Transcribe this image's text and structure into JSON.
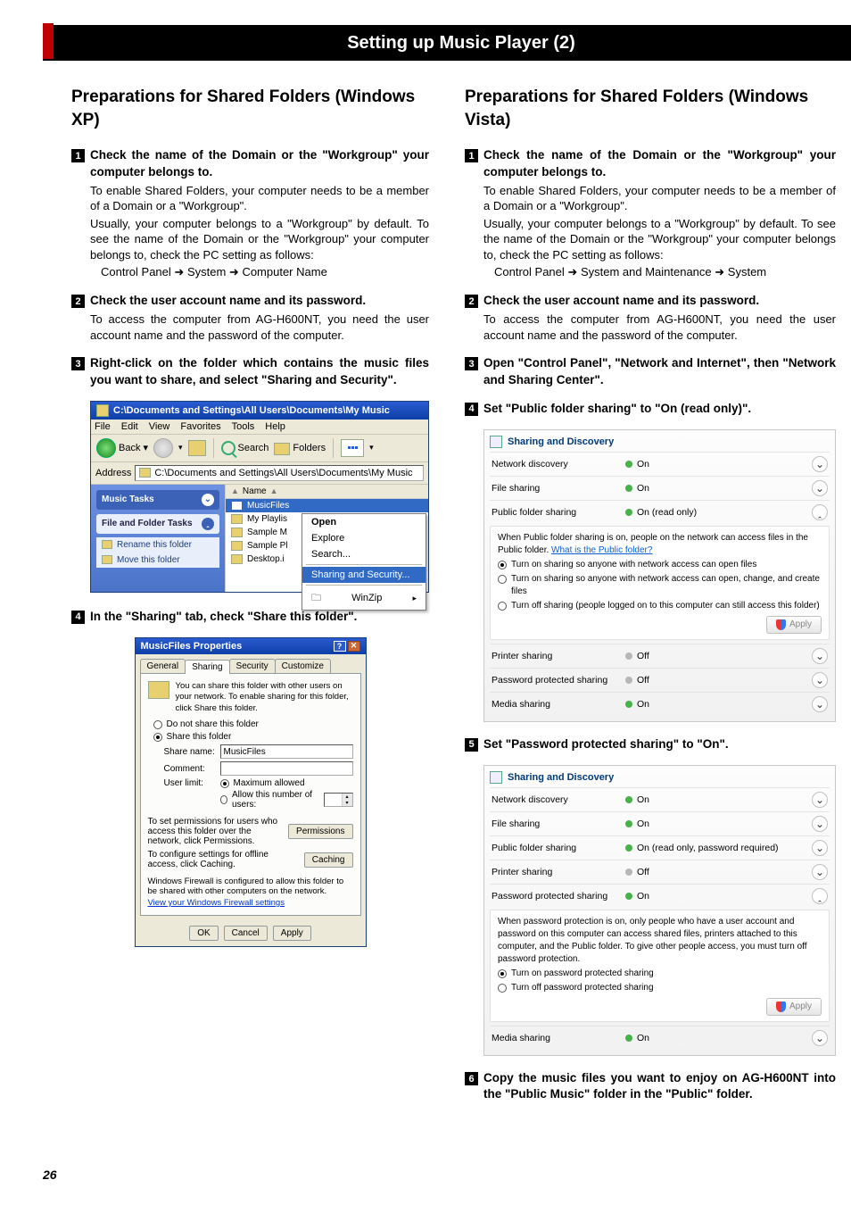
{
  "page_number": "26",
  "band_title": "Setting up Music Player (2)",
  "xp": {
    "section_title": "Preparations for Shared Folders (Windows XP)",
    "steps": {
      "s1": {
        "num": "1",
        "title": "Check the name of the Domain or the \"Workgroup\" your computer belongs to.",
        "p1": "To enable Shared Folders, your computer needs to be a member of a Domain or a \"Workgroup\".",
        "p2": "Usually, your computer belongs to a \"Workgroup\" by default. To see the name of the Domain or the \"Workgroup\" your computer belongs to, check the PC setting as follows:",
        "path_a": "Control Panel",
        "path_b": "System",
        "path_c": "Computer Name"
      },
      "s2": {
        "num": "2",
        "title": "Check the user account name and its password.",
        "p1": "To access the computer from AG-H600NT, you need the user account name and the password of the computer."
      },
      "s3": {
        "num": "3",
        "title": "Right-click on the folder which contains the music files you want to share, and select \"Sharing and Security\"."
      },
      "s4": {
        "num": "4",
        "title": "In the \"Sharing\" tab, check \"Share this folder\"."
      }
    },
    "explorer": {
      "title": "C:\\Documents and Settings\\All Users\\Documents\\My Music",
      "menus": [
        "File",
        "Edit",
        "View",
        "Favorites",
        "Tools",
        "Help"
      ],
      "toolbar": {
        "back": "Back",
        "search": "Search",
        "folders": "Folders"
      },
      "address_label": "Address",
      "address_value": "C:\\Documents and Settings\\All Users\\Documents\\My Music",
      "tasks": {
        "music": "Music Tasks",
        "filefolder": "File and Folder Tasks",
        "rename": "Rename this folder",
        "move": "Move this folder"
      },
      "filehdr": "Name",
      "files": [
        "MusicFiles",
        "My Playlis",
        "Sample M",
        "Sample Pl",
        "Desktop.i"
      ],
      "ctx": {
        "open": "Open",
        "explore": "Explore",
        "search": "Search...",
        "sharing": "Sharing and Security...",
        "winzip": "WinZip"
      }
    },
    "props": {
      "title": "MusicFiles Properties",
      "tabs": [
        "General",
        "Sharing",
        "Security",
        "Customize"
      ],
      "info": "You can share this folder with other users on your network.   To enable sharing for this folder, click Share this folder.",
      "r_noshare": "Do not share this folder",
      "r_share": "Share this folder",
      "share_name_lbl": "Share name:",
      "share_name_val": "MusicFiles",
      "comment_lbl": "Comment:",
      "userlimit_lbl": "User limit:",
      "r_max": "Maximum allowed",
      "r_allow": "Allow this number of users:",
      "perm_text": "To set permissions for users who access this folder over the network, click Permissions.",
      "perm_btn": "Permissions",
      "cache_text": "To configure settings for offline access, click Caching.",
      "cache_btn": "Caching",
      "firewall_note": "Windows Firewall is configured to allow this folder to be shared with other computers on the network.",
      "firewall_link": "View your Windows Firewall settings",
      "btn_ok": "OK",
      "btn_cancel": "Cancel",
      "bt― apply": "Apply",
      "btn_apply": "Apply"
    }
  },
  "vista": {
    "section_title": "Preparations for Shared Folders (Windows Vista)",
    "steps": {
      "s1": {
        "num": "1",
        "title": "Check the name of the Domain or the \"Workgroup\" your computer belongs to.",
        "p1": "To enable Shared Folders, your computer needs to be a member of a Domain or a \"Workgroup\".",
        "p2": "Usually, your computer belongs to a \"Workgroup\" by default. To see the name of the Domain or the \"Workgroup\" your computer belongs to, check the PC setting as follows:",
        "path_a": "Control Panel",
        "path_b": "System and Maintenance",
        "path_c": "System"
      },
      "s2": {
        "num": "2",
        "title": "Check the user account name and its password.",
        "p1": "To access the computer from AG-H600NT, you need the user account name and the password of the computer."
      },
      "s3": {
        "num": "3",
        "title": "Open \"Control Panel\", \"Network and Internet\", then \"Network and Sharing Center\"."
      },
      "s4": {
        "num": "4",
        "title": "Set \"Public folder sharing\" to \"On (read only)\"."
      },
      "s5": {
        "num": "5",
        "title": "Set \"Password protected sharing\" to \"On\"."
      },
      "s6": {
        "num": "6",
        "title": "Copy the music files you want to enjoy on AG-H600NT into the \"Public Music\" folder in the \"Public\" folder."
      }
    },
    "panel1": {
      "hdr": "Sharing and Discovery",
      "rows": {
        "net": "Network discovery",
        "net_v": "On",
        "file": "File sharing",
        "file_v": "On",
        "pub": "Public folder sharing",
        "pub_v": "On (read only)",
        "printer": "Printer sharing",
        "printer_v": "Off",
        "pwd": "Password protected sharing",
        "pwd_v": "Off",
        "media": "Media sharing",
        "media_v": "On"
      },
      "exp": {
        "lead": "When Public folder sharing is on, people on the network can access files in the Public folder. ",
        "link1": "What is the Public folder?",
        "r1": "Turn on sharing so anyone with network access can open files",
        "r2": "Turn on sharing so anyone with network access can open, change, and create files",
        "r3": "Turn off sharing (people logged on to this computer can still access this folder)",
        "apply": "Apply"
      }
    },
    "panel2": {
      "hdr": "Sharing and Discovery",
      "rows": {
        "net": "Network discovery",
        "net_v": "On",
        "file": "File sharing",
        "file_v": "On",
        "pub": "Public folder sharing",
        "pub_v": "On (read only, password required)",
        "printer": "Printer sharing",
        "printer_v": "Off",
        "pwd": "Password protected sharing",
        "pwd_v": "On",
        "media": "Media sharing",
        "media_v": "On"
      },
      "exp": {
        "lead": "When password protection is on, only people who have a user account and password on this computer can access shared files, printers attached to this computer, and the Public folder. To give other people access, you must turn off password protection.",
        "r1": "Turn on password protected sharing",
        "r2": "Turn off password protected sharing",
        "apply": "Apply"
      }
    }
  }
}
